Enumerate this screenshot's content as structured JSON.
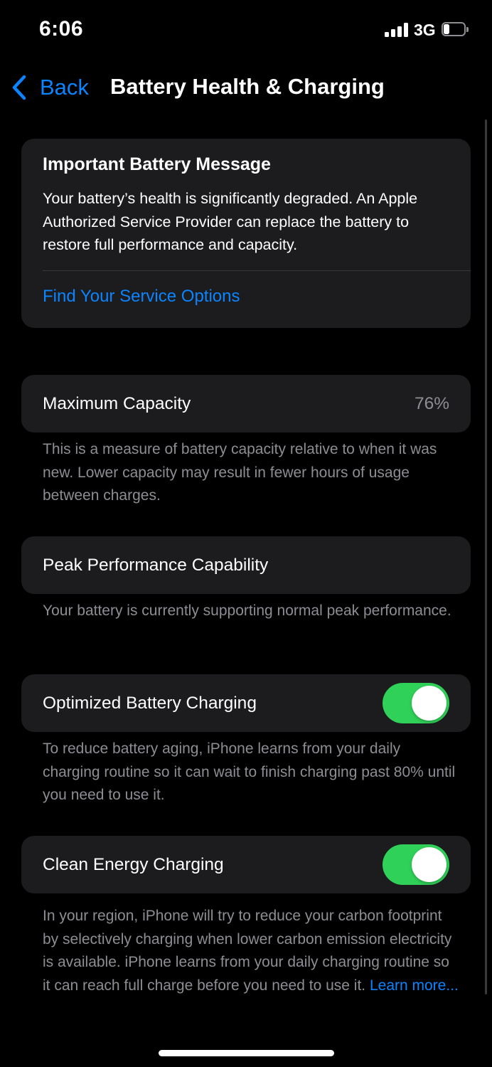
{
  "status_bar": {
    "time": "6:06",
    "network": "3G",
    "signal_bars": 4,
    "battery_level_fraction": 0.3
  },
  "nav": {
    "back_label": "Back",
    "title": "Battery Health & Charging"
  },
  "alert": {
    "title": "Important Battery Message",
    "body": "Your battery’s health is significantly degraded. An Apple Authorized Service Provider can replace the battery to restore full performance and capacity.",
    "link": "Find Your Service Options"
  },
  "max_capacity": {
    "label": "Maximum Capacity",
    "value": "76%",
    "footnote": "This is a measure of battery capacity relative to when it was new. Lower capacity may result in fewer hours of usage between charges."
  },
  "peak_performance": {
    "label": "Peak Performance Capability",
    "footnote": "Your battery is currently supporting normal peak performance."
  },
  "optimized_charging": {
    "label": "Optimized Battery Charging",
    "enabled": true,
    "footnote": "To reduce battery aging, iPhone learns from your daily charging routine so it can wait to finish charging past 80% until you need to use it."
  },
  "clean_energy": {
    "label": "Clean Energy Charging",
    "enabled": true,
    "footnote": "In your region, iPhone will try to reduce your carbon footprint by selectively charging when lower carbon emission electricity is available. iPhone learns from your daily charging routine so it can reach full charge before you need to use it.",
    "learn_more": "Learn more..."
  },
  "colors": {
    "background": "#000000",
    "card": "#1c1c1e",
    "accent_blue": "#0a84ff",
    "toggle_on": "#30d158",
    "secondary_text": "#8d8d93"
  },
  "icons": {
    "back": "chevron-left-icon",
    "signal": "cellular-signal-icon",
    "battery": "battery-icon"
  }
}
